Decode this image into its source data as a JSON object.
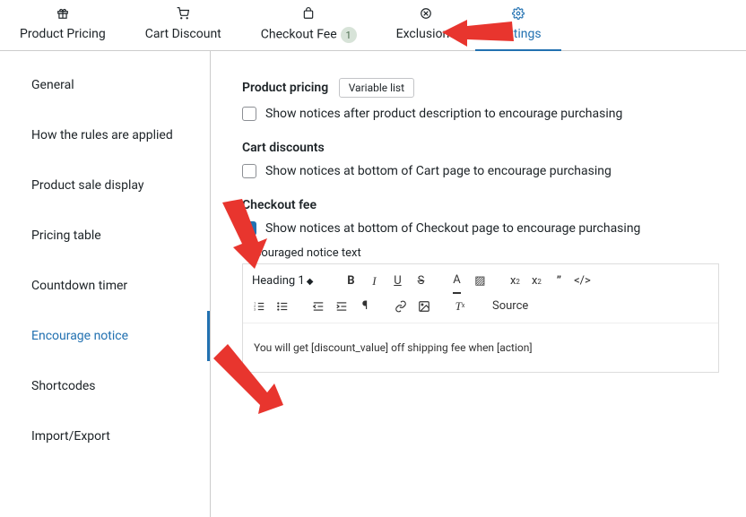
{
  "tabs": {
    "t0": {
      "label": "Product Pricing"
    },
    "t1": {
      "label": "Cart Discount"
    },
    "t2": {
      "label": "Checkout Fee",
      "badge": "1"
    },
    "t3": {
      "label": "Exclusions"
    },
    "t4": {
      "label": "Settings"
    }
  },
  "sidebar": {
    "s0": "General",
    "s1": "How the rules are applied",
    "s2": "Product sale display",
    "s3": "Pricing table",
    "s4": "Countdown timer",
    "s5": "Encourage notice",
    "s6": "Shortcodes",
    "s7": "Import/Export"
  },
  "content": {
    "product_pricing": {
      "title": "Product pricing",
      "btn": "Variable list",
      "cb_label": "Show notices after product description to encourage purchasing"
    },
    "cart_discounts": {
      "title": "Cart discounts",
      "cb_label": "Show notices at bottom of Cart page to encourage purchasing"
    },
    "checkout_fee": {
      "title": "Checkout fee",
      "cb_label": "Show notices at bottom of Checkout page to encourage purchasing",
      "field_label": "Encouraged notice text",
      "body": "You will get [discount_value] off shipping fee when [action]"
    },
    "editor": {
      "heading": "Heading 1",
      "source": "Source"
    }
  }
}
